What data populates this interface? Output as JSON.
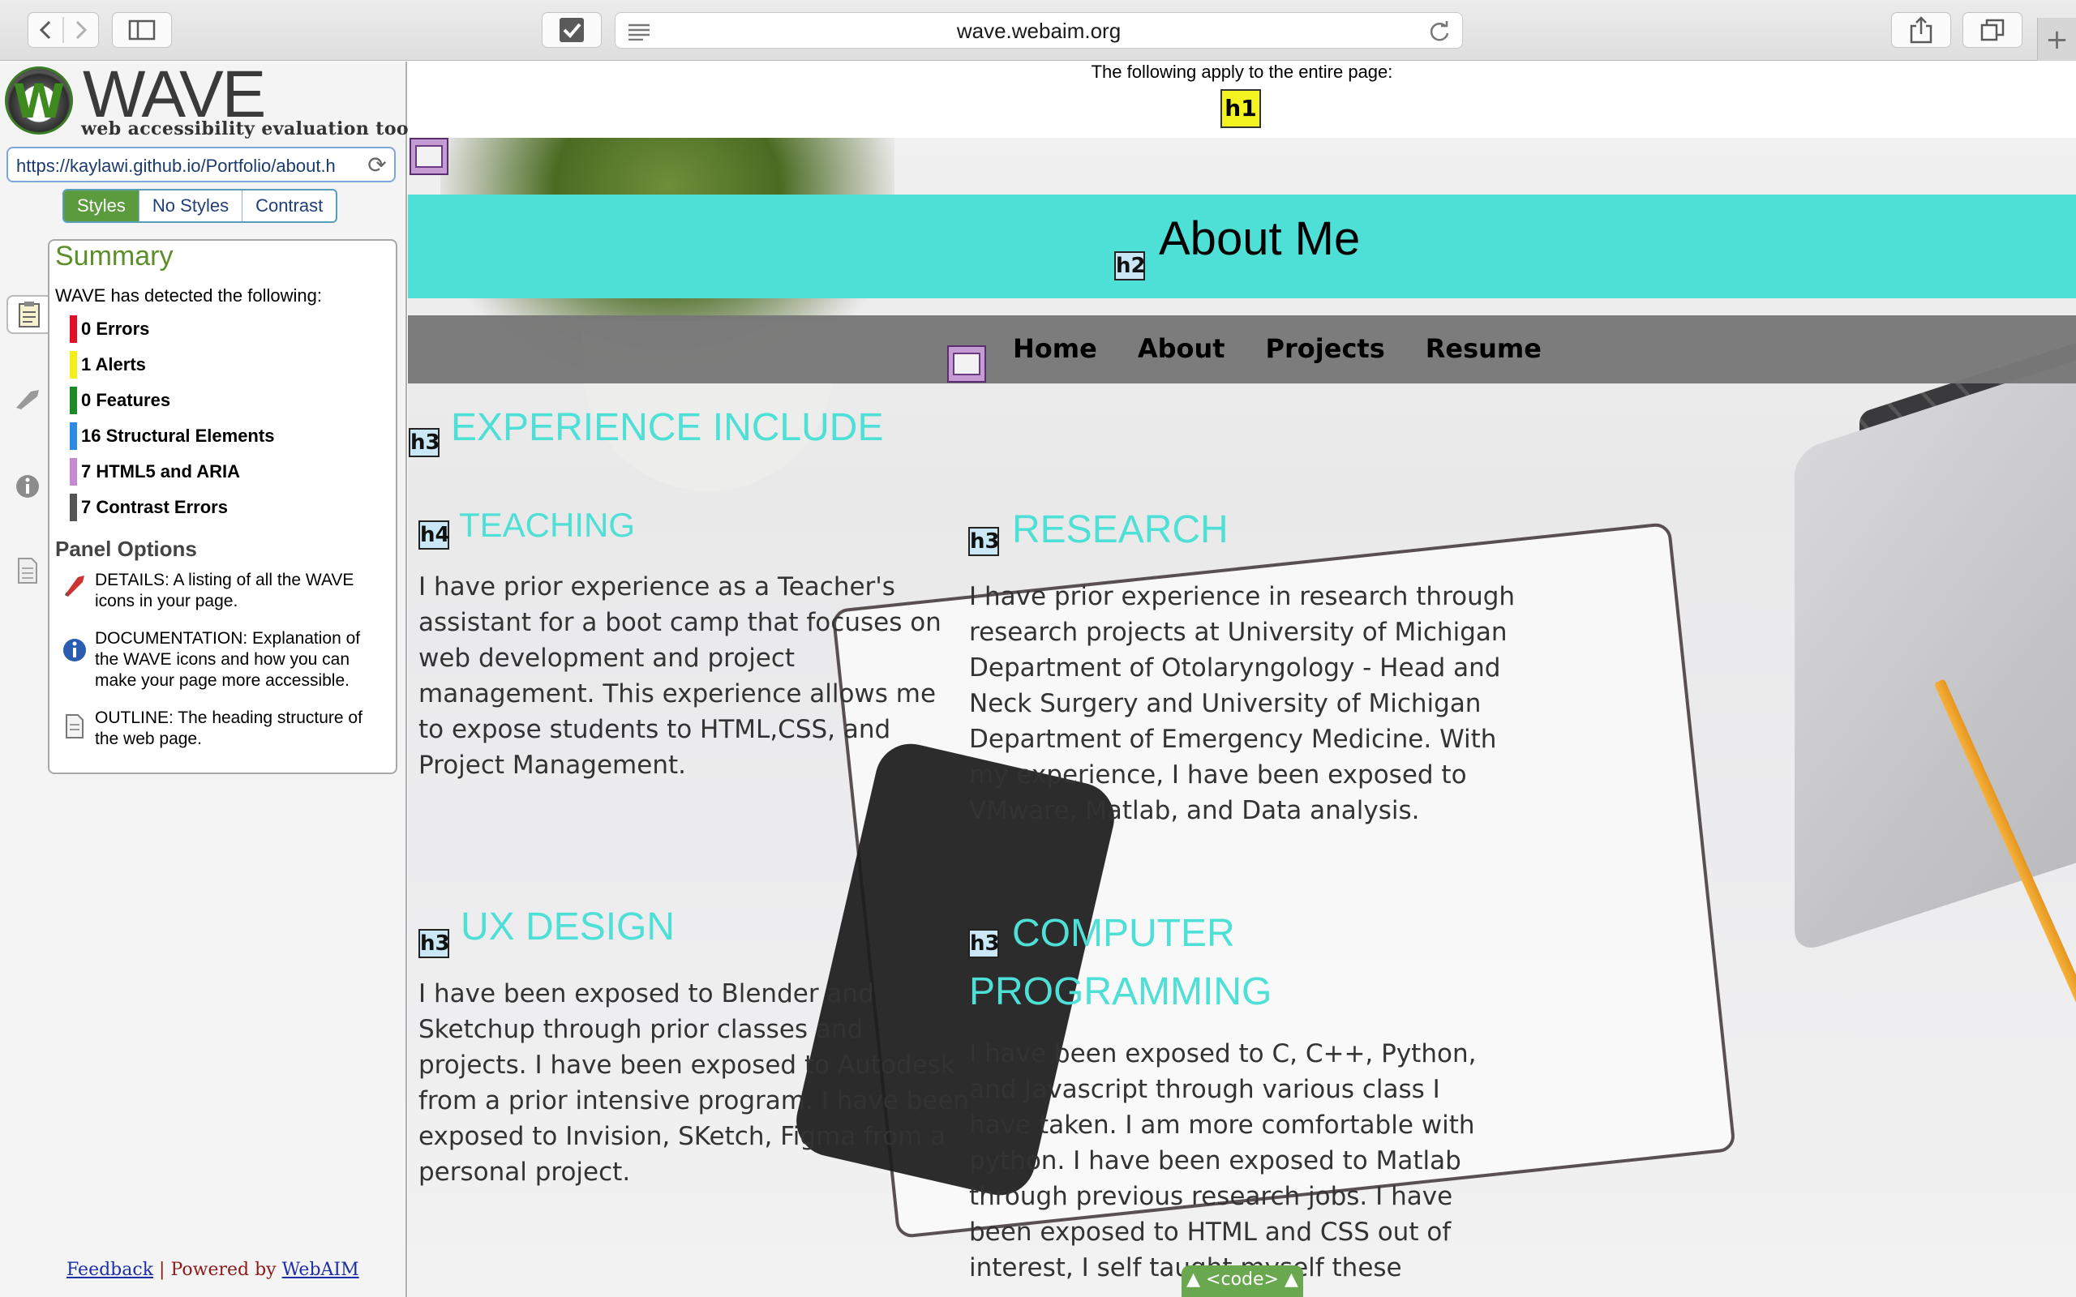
{
  "browser": {
    "address": "wave.webaim.org",
    "new_tab": "+"
  },
  "wave": {
    "logo_letter": "W",
    "title": "WAVE",
    "subtitle": "web accessibility evaluation tool",
    "url_value": "https://kaylawi.github.io/Portfolio/about.h",
    "modes": [
      "Styles",
      "No Styles",
      "Contrast"
    ],
    "summary": {
      "title": "Summary",
      "detected": "WAVE has detected the following:",
      "items": [
        {
          "label": "0 Errors",
          "color": "#e0102b"
        },
        {
          "label": "1 Alerts",
          "color": "#f3ef1a"
        },
        {
          "label": "0 Features",
          "color": "#1e8a24"
        },
        {
          "label": "16 Structural Elements",
          "color": "#2b8be0"
        },
        {
          "label": "7 HTML5 and ARIA",
          "color": "#c48bd1"
        },
        {
          "label": "7 Contrast Errors",
          "color": "#555555"
        }
      ]
    },
    "panel_options": {
      "title": "Panel Options",
      "details": "DETAILS: A listing of all the WAVE icons in your page.",
      "documentation": "DOCUMENTATION: Explanation of the WAVE icons and how you can make your page more accessible.",
      "outline": "OUTLINE: The heading structure of the web page."
    },
    "footer": {
      "feedback": "Feedback",
      "separator": "|",
      "powered": "Powered by",
      "webaim": "WebAIM"
    }
  },
  "page": {
    "top_note": "The following apply to the entire page:",
    "h1_tag": "h1",
    "about_title": "About Me",
    "nav": [
      "Home",
      "About",
      "Projects",
      "Resume"
    ],
    "tags": {
      "h2": "h2",
      "h3": "h3",
      "h4": "h4"
    },
    "experience_heading": "EXPERIENCE INCLUDE",
    "teaching": {
      "heading": "TEACHING",
      "body": "I have prior experience as a Teacher's assistant for a boot camp that focuses on web development and project management. This experience allows me to expose students to HTML,CSS, and Project Management."
    },
    "research": {
      "heading": "RESEARCH",
      "body": "I have prior experience in research through research projects at University of Michigan Department of Otolaryngology - Head and Neck Surgery and University of Michigan Department of Emergency Medicine. With my experience, I have been exposed to VMware, Matlab, and Data analysis."
    },
    "ux": {
      "heading": "UX DESIGN",
      "body": "I have been exposed to Blender and Sketchup through prior classes and projects. I have been exposed to Autodesk from a prior intensive program. I have been exposed to Invision, SKetch, Figma from a personal project."
    },
    "programming": {
      "heading": "COMPUTER PROGRAMMING",
      "body": "I have been exposed to C, C++, Python, and Javascript through various class I have taken. I am more comfortable with python. I have been exposed to Matlab through previous research jobs. I have been exposed to HTML and CSS out of interest, I self taught myself these"
    },
    "code_tab": "▲ <code> ▲"
  }
}
